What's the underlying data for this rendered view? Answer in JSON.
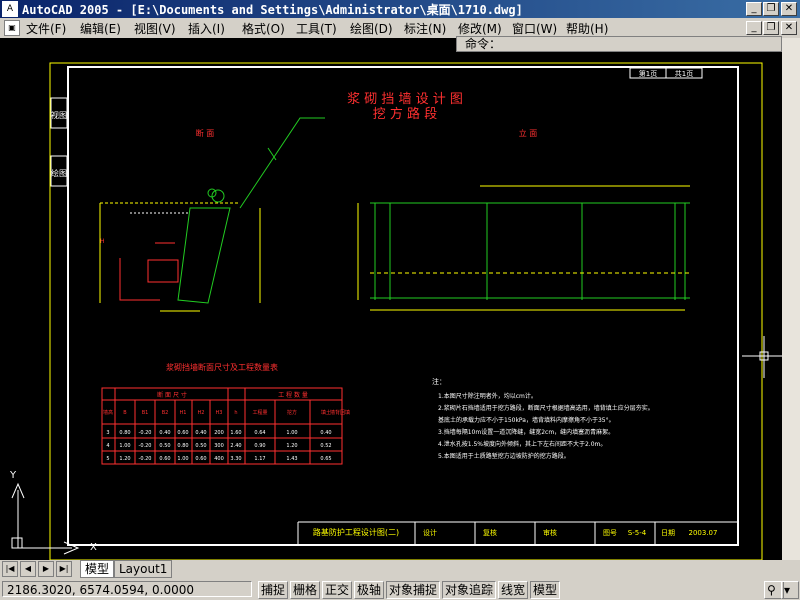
{
  "window": {
    "title": "AutoCAD 2005 - [E:\\Documents and Settings\\Administrator\\桌面\\1710.dwg]",
    "app_icon": "acad-icon",
    "minimize": "_",
    "restore": "❐",
    "close": "✕"
  },
  "menu": [
    {
      "label": "文件(F)"
    },
    {
      "label": "编辑(E)"
    },
    {
      "label": "视图(V)"
    },
    {
      "label": "插入(I)"
    },
    {
      "label": "格式(O)"
    },
    {
      "label": "工具(T)"
    },
    {
      "label": "绘图(D)"
    },
    {
      "label": "标注(N)"
    },
    {
      "label": "修改(M)"
    },
    {
      "label": "窗口(W)"
    },
    {
      "label": "帮助(H)"
    }
  ],
  "command": {
    "prompt": "命令："
  },
  "drawing": {
    "sheet_label": "第1页",
    "sheet_total": "共1页",
    "title_line1": "浆 砌 挡 墙 设 计 图",
    "title_line2": "挖 方 路 段",
    "section_label": "断 面",
    "elevation_label": "立 面",
    "table_title": "浆砌挡墙断面尺寸及工程数量表",
    "table_head_group1": "断 面 尺 寸",
    "table_head_group2": "工 程 数 量",
    "table_cols": [
      "墙高",
      "B",
      "B1",
      "B2",
      "H1",
      "H2",
      "H3",
      "h",
      "工程量",
      "挖方",
      "填土",
      "墙背回填"
    ],
    "table_rows": [
      [
        "3",
        "0.80",
        "-0.20",
        "0.40",
        "0.60",
        "0.40",
        "200",
        "1.60",
        "0.64",
        "1.00",
        "0.40"
      ],
      [
        "4",
        "1.00",
        "-0.20",
        "0.50",
        "0.80",
        "0.50",
        "300",
        "2.40",
        "0.90",
        "1.20",
        "0.52"
      ],
      [
        "5",
        "1.20",
        "-0.20",
        "0.60",
        "1.00",
        "0.60",
        "400",
        "3.30",
        "1.17",
        "1.43",
        "0.65"
      ]
    ],
    "notes_title": "注：",
    "notes": [
      "1.本图尺寸除注明者外，均以cm计。",
      "2.浆砌片石挡墙适用于挖方路段，断面尺寸根据墙高选用，墙背填土应分层夯实。",
      "   基底土的承载力应不小于150kPa，墙背填料内摩擦角不小于35°。",
      "3.挡墙每隔10m设置一道沉降缝，缝宽2cm，缝内填塞沥青麻絮。",
      "4.泄水孔按1.5%坡度向外倾斜，其上下左右间距不大于2.0m。",
      "5.本图适用于土质路堑挖方边坡防护的挖方路段。"
    ],
    "titleblock_name": "路基防护工程设计图(二)",
    "titleblock_design": "设计",
    "titleblock_review": "复核",
    "titleblock_audit": "审核",
    "titleblock_drawno": "图号",
    "titleblock_drawno_val": "S-5-4",
    "titleblock_date": "日期",
    "titleblock_date_val": "2003.07",
    "side_tag1": "视图",
    "side_tag2": "绘图",
    "ucs_y": "Y",
    "ucs_x": "X"
  },
  "tabs": {
    "model": "模型",
    "layout1": "Layout1"
  },
  "status": {
    "coords": "2186.3020,  6574.0594,  0.0000",
    "buttons": [
      {
        "label": "捕捉",
        "on": false
      },
      {
        "label": "栅格",
        "on": false
      },
      {
        "label": "正交",
        "on": false
      },
      {
        "label": "极轴",
        "on": false
      },
      {
        "label": "对象捕捉",
        "on": true
      },
      {
        "label": "对象追踪",
        "on": true
      },
      {
        "label": "线宽",
        "on": false
      },
      {
        "label": "模型",
        "on": true
      }
    ]
  },
  "colors": {
    "canvas": "#000000",
    "titlebar": "#0a246a",
    "red": "#ff3030",
    "green": "#22cc22",
    "yellow": "#ffff00",
    "white": "#ffffff"
  }
}
